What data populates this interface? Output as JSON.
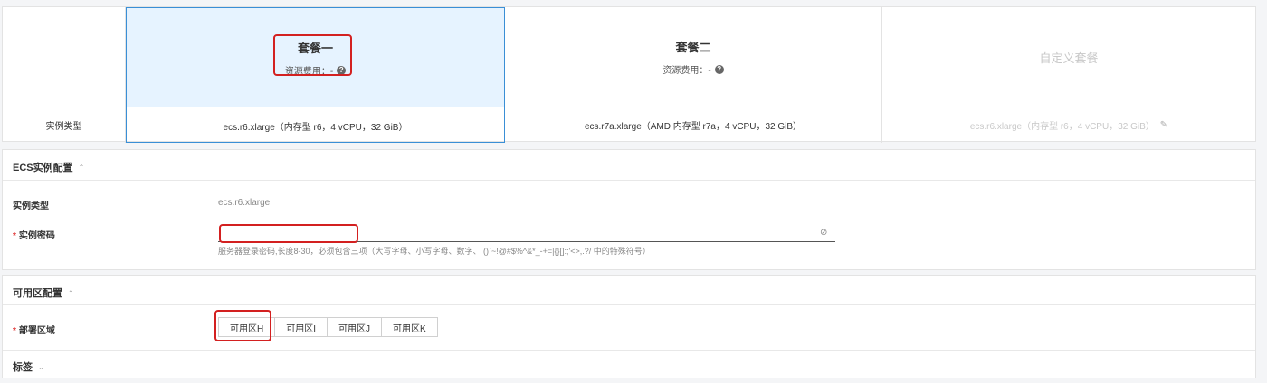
{
  "plans": {
    "row_label": "实例类型",
    "fee_label": "资源费用：-",
    "items": [
      {
        "name": "套餐一",
        "instance": "ecs.r6.xlarge（内存型 r6，4 vCPU，32 GiB）"
      },
      {
        "name": "套餐二",
        "instance": "ecs.r7a.xlarge（AMD 内存型 r7a，4 vCPU，32 GiB）"
      },
      {
        "name": "自定义套餐",
        "instance": "ecs.r6.xlarge（内存型 r6，4 vCPU，32 GiB）"
      }
    ]
  },
  "ecs": {
    "title": "ECS实例配置",
    "type_label": "实例类型",
    "type_value": "ecs.r6.xlarge",
    "pwd_label": "实例密码",
    "pwd_value": "",
    "pwd_hint": "服务器登录密码,长度8-30，必须包含三项（大写字母、小写字母、数字、 ()`~!@#$%^&*_-+=|{}[]:;'<>,.?/ 中的特殊符号）"
  },
  "zone": {
    "title": "可用区配置",
    "deploy_label": "部署区域",
    "options": [
      "可用区H",
      "可用区I",
      "可用区J",
      "可用区K"
    ]
  },
  "tags": {
    "title": "标签"
  }
}
